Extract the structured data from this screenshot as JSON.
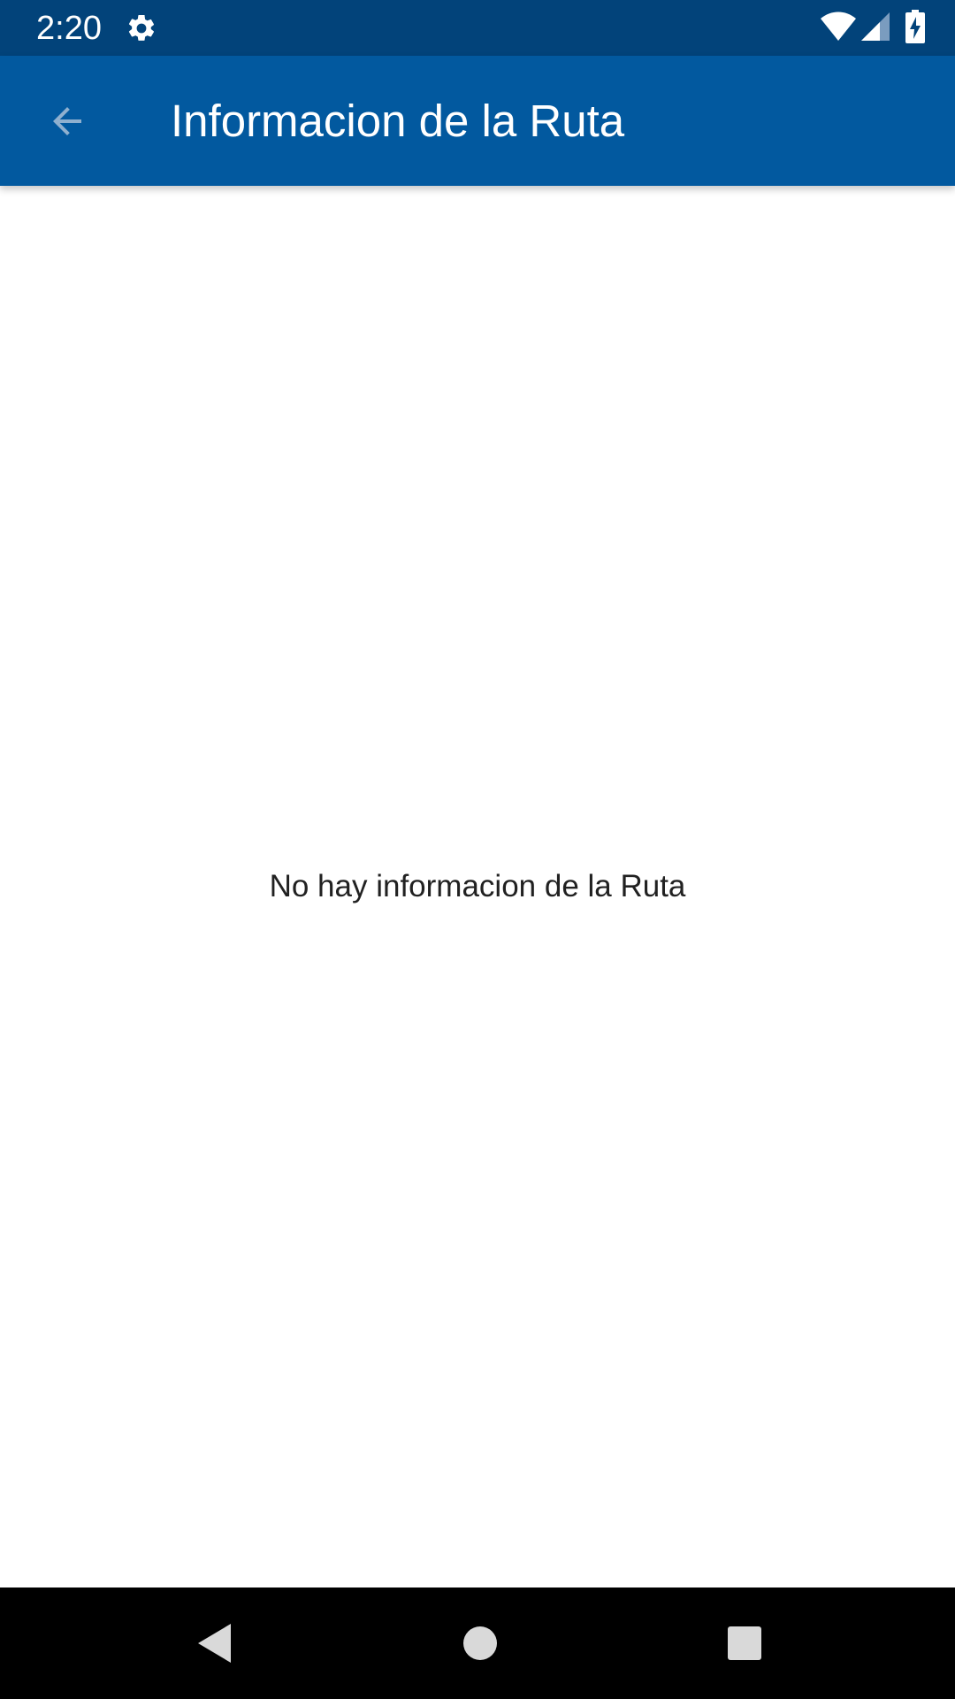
{
  "status_bar": {
    "time": "2:20",
    "background": "#02437a",
    "icons": [
      "settings-gear-icon",
      "wifi-icon",
      "cell-signal-icon",
      "battery-charging-icon"
    ]
  },
  "app_bar": {
    "title": "Informacion de la Ruta",
    "background": "#02599f",
    "back_icon": "arrow-left-icon"
  },
  "content": {
    "empty_message": "No hay informacion de la Ruta"
  },
  "nav_bar": {
    "buttons": [
      "back-triangle-icon",
      "home-circle-icon",
      "recents-square-icon"
    ]
  }
}
